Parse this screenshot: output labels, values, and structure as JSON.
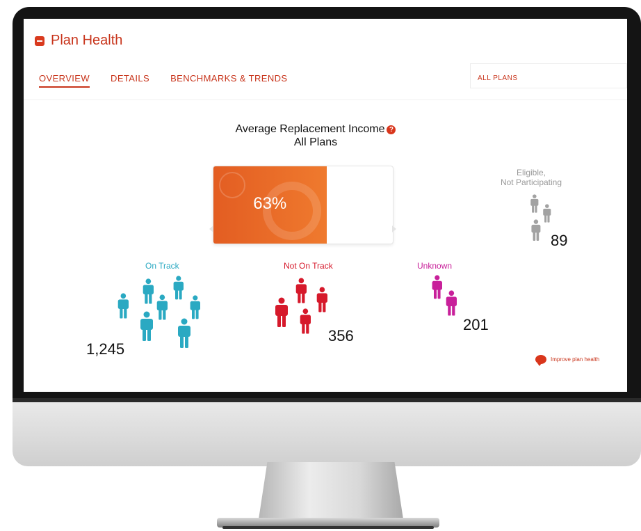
{
  "app": {
    "title": "Plan Health"
  },
  "tabs": [
    {
      "label": "OVERVIEW",
      "active": true
    },
    {
      "label": "DETAILS",
      "active": false
    },
    {
      "label": "BENCHMARKS & TRENDS",
      "active": false
    }
  ],
  "plan_filter": {
    "selected": "ALL PLANS"
  },
  "replacement_income": {
    "title": "Average Replacement Income",
    "subtitle": "All Plans",
    "help_icon": "question-icon",
    "percent_label": "63%",
    "percent": 63
  },
  "groups": {
    "eligible": {
      "label_line1": "Eligible,",
      "label_line2": "Not Participating",
      "count": "89",
      "color": "#a2a2a2",
      "icon": "people-icon"
    },
    "on_track": {
      "label": "On Track",
      "count": "1,245",
      "color": "#2aa9c2",
      "icon": "people-icon"
    },
    "not_on_track": {
      "label": "Not On Track",
      "count": "356",
      "color": "#d6192b",
      "icon": "people-icon"
    },
    "unknown": {
      "label": "Unknown",
      "count": "201",
      "color": "#c8209a",
      "icon": "people-icon"
    }
  },
  "improve_link": {
    "label": "Improve plan health",
    "icon": "speech-bubble-icon"
  },
  "colors": {
    "accent": "#c8341b",
    "bar": "#e96a28"
  }
}
